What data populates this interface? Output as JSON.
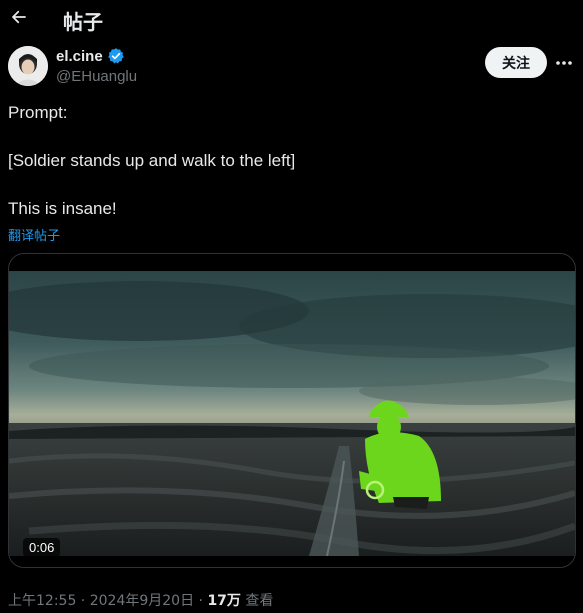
{
  "header": {
    "title": "帖子",
    "back_icon": "arrow-left-icon"
  },
  "author": {
    "display_name": "el.cine",
    "handle": "@EHuanglu",
    "verified_color": "#1d9bf0"
  },
  "follow_label": "关注",
  "tweet": {
    "lines": [
      "Prompt:",
      "[Soldier stands up and walk to the left]",
      "This is insane!"
    ],
    "translate_label": "翻译帖子"
  },
  "video": {
    "timecode": "0:06"
  },
  "meta": {
    "time": "上午12:55",
    "sep1": " · ",
    "date": "2024年9月20日",
    "sep2": " · ",
    "views": "17万",
    "views_label": " 查看"
  },
  "colors": {
    "accent": "#1d9bf0",
    "highlight": "#6cd61c"
  }
}
